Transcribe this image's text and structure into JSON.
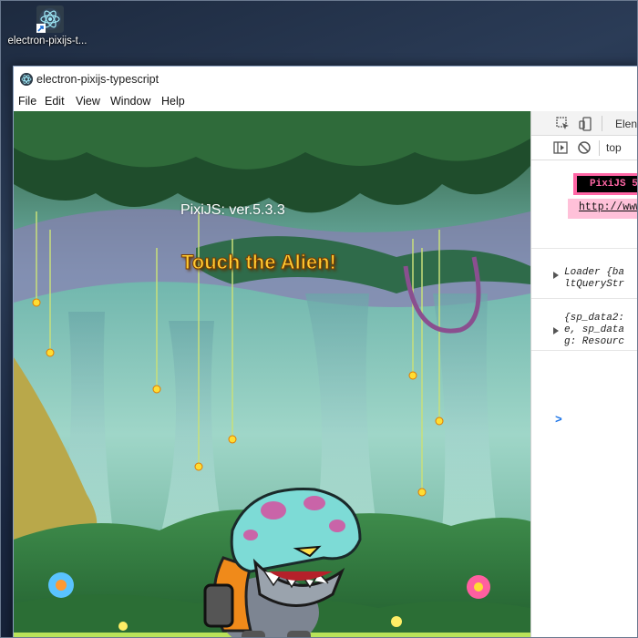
{
  "desktop": {
    "icon_label": "electron-pixijs-t..."
  },
  "window": {
    "title": "electron-pixijs-typescript",
    "menu": [
      "File",
      "Edit",
      "View",
      "Window",
      "Help"
    ]
  },
  "game": {
    "version_text": "PixiJS: ver.5.3.3",
    "instruction_text": "Touch the Alien!"
  },
  "devtools": {
    "tab_elements": "Elen",
    "context_select": "top",
    "pixi_banner": "PixiJS 5",
    "pixi_link": "http://www",
    "log_loader_line1": "Loader {ba",
    "log_loader_line2": "ltQueryStr",
    "log_data_line1": "{sp_data2:",
    "log_data_line2": "e, sp_data",
    "log_data_line3": "g: Resourc",
    "prompt": ">"
  },
  "colors": {
    "banner_pink": "#ff66a5",
    "link_bg": "#ffc1d9",
    "prompt_blue": "#1a73e8",
    "title_yellow": "#ffcc33"
  }
}
